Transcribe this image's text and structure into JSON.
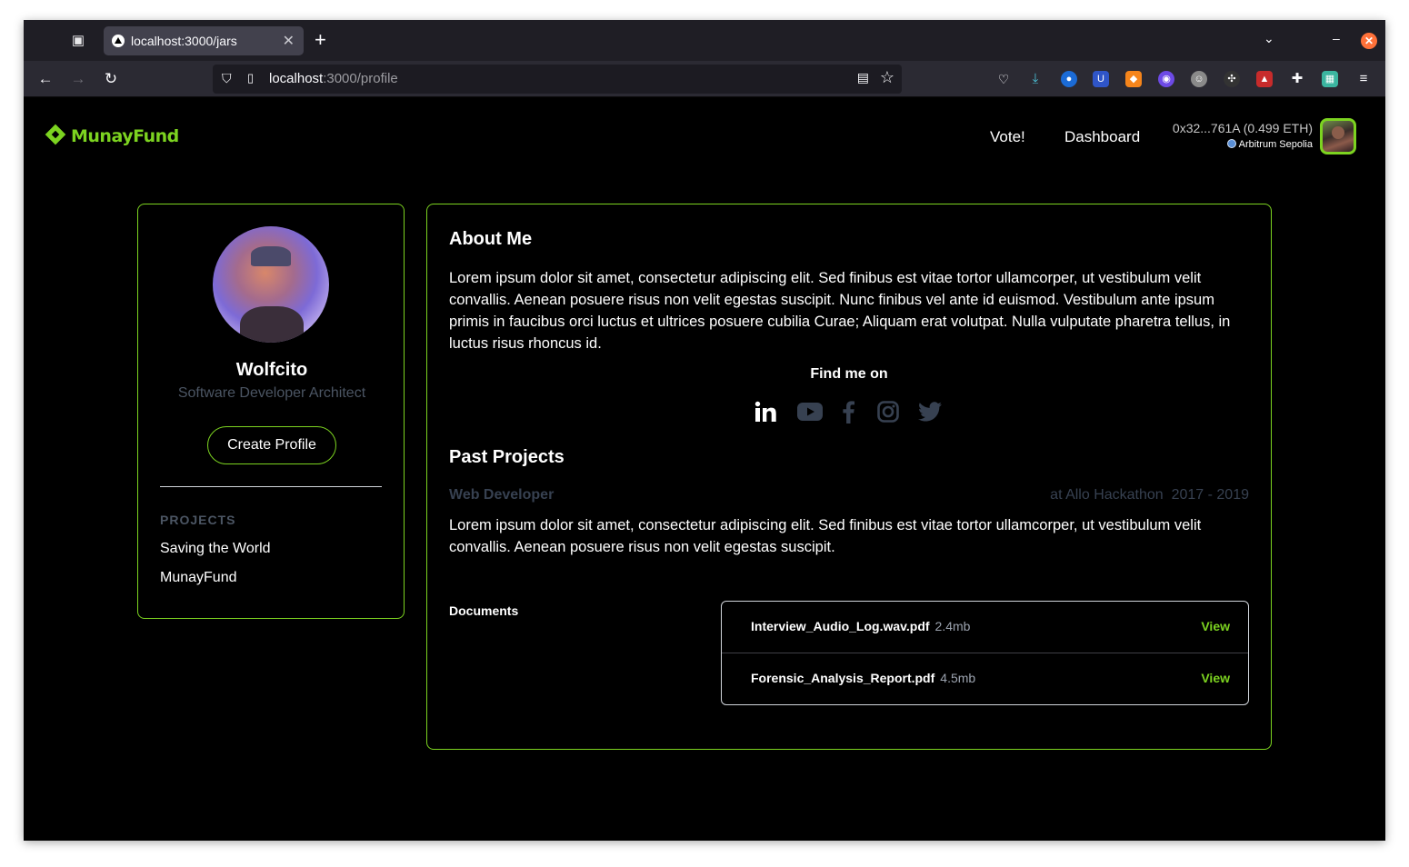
{
  "browser": {
    "tab_title": "localhost:3000/jars",
    "url_host": "localhost",
    "url_rest": ":3000/profile"
  },
  "brand": {
    "name": "MunayFund",
    "accent_color": "#7cd320"
  },
  "nav": {
    "vote_label": "Vote!",
    "dashboard_label": "Dashboard"
  },
  "wallet": {
    "address": "0x32...761A (0.499 ETH)",
    "network": "Arbitrum Sepolia"
  },
  "profile": {
    "name": "Wolfcito",
    "role": "Software Developer Architect",
    "create_button": "Create Profile",
    "projects_heading": "PROJECTS",
    "projects": [
      "Saving the World",
      "MunayFund"
    ]
  },
  "about": {
    "title": "About Me",
    "text": "Lorem ipsum dolor sit amet, consectetur adipiscing elit. Sed finibus est vitae tortor ullamcorper, ut vestibulum velit convallis. Aenean posuere risus non velit egestas suscipit. Nunc finibus vel ante id euismod. Vestibulum ante ipsum primis in faucibus orci luctus et ultrices posuere cubilia Curae; Aliquam erat volutpat. Nulla vulputate pharetra tellus, in luctus risus rhoncus id.",
    "find_me": "Find me on",
    "socials": [
      "linkedin-icon",
      "youtube-icon",
      "facebook-icon",
      "instagram-icon",
      "twitter-icon"
    ]
  },
  "past_projects": {
    "title": "Past Projects",
    "job_title": "Web Developer",
    "job_place": "at Allo Hackathon",
    "job_years": "2017 - 2019",
    "job_text": "Lorem ipsum dolor sit amet, consectetur adipiscing elit. Sed finibus est vitae tortor ullamcorper, ut vestibulum velit convallis. Aenean posuere risus non velit egestas suscipit."
  },
  "documents": {
    "label": "Documents",
    "items": [
      {
        "name": "Interview_Audio_Log.wav.pdf",
        "size": "2.4mb",
        "action": "View"
      },
      {
        "name": "Forensic_Analysis_Report.pdf",
        "size": "4.5mb",
        "action": "View"
      }
    ]
  }
}
